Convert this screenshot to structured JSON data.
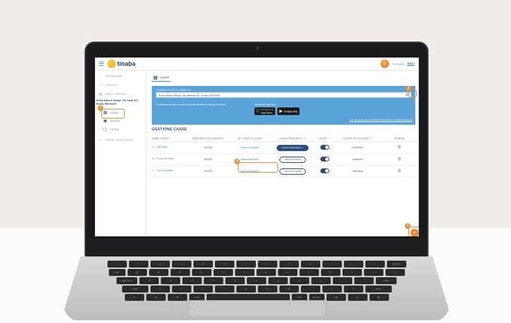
{
  "header": {
    "logo_text": "tinaba",
    "user_name": "TINTINBA",
    "exit_label": "ESCI"
  },
  "sidebar": {
    "items": [
      {
        "label": "DASHBOARD"
      },
      {
        "label": "PROFILO"
      },
      {
        "label": "PUNTI VENDITA"
      }
    ],
    "pv_address": "Roma Marmo Village, Via Casal 547, Roma, RM 00128",
    "sub_items": [
      {
        "label": "CASSE"
      },
      {
        "label": "SERATE"
      },
      {
        "label": "LISTINI"
      }
    ],
    "grow_label": "GROW YOUR CLIENT"
  },
  "tab": {
    "label": "CASSE"
  },
  "pv_panel": {
    "title": "CAMBIA PUNTO VENDITA",
    "selected": "Roma Marmo Village, Via Ustrenes 547, Roma, RM 00128",
    "help_text": "Per attivare una cassa, inserisci il codice attivazione nell'app per tinaba",
    "store_title": "Disponibile sugli store",
    "app_store_small": "Download on the",
    "app_store_label": "App Store",
    "google_play_label": "Google play",
    "link_text": "a clic qui per sapere come attivare i POS di Amazon e Bitcoin/l'assistenza"
  },
  "section_title": "GESTIONE CASSE",
  "table": {
    "headers": [
      "NOME CASSA",
      "IDENTIFICATIVO UNIVOCO",
      "QR CODE DI CASSA",
      "CASSA PRINCIPALE ⓘ",
      "STATO ⓘ",
      "CODICE ATTIVAZIONE ⓘ",
      "ELIMINA"
    ],
    "rows": [
      {
        "name": "BAR Bisso",
        "id": "1001282",
        "qr": "Scarica espositore",
        "principal": "CASSA PRINCIPALE ✓",
        "code": "mX9RjzBK1"
      },
      {
        "name": "Prova Punt Bisso",
        "id": "1001302",
        "qr": "Scarica espositore",
        "principal": "Cassa Secondaria",
        "code": "ur9yfcpu2c"
      },
      {
        "name": "Prova Log Bisso",
        "id": "1001303",
        "qr": "Scarica espositore",
        "principal": "Cassa Secondaria",
        "code": "qo5iZjnvIs"
      }
    ]
  },
  "callouts": [
    "1",
    "2",
    "3",
    "4"
  ],
  "fab_label": "+",
  "keyboard": {
    "row1": [
      "~",
      "!",
      "@",
      "#",
      "$",
      "%",
      "^",
      "&",
      "*",
      "(",
      ")",
      "_",
      "+",
      "delete"
    ],
    "row2": [
      "tab",
      "Q",
      "W",
      "E",
      "R",
      "T",
      "Y",
      "U",
      "I",
      "O",
      "P",
      "{",
      "}",
      "|"
    ],
    "row3": [
      "caps lock",
      "A",
      "S",
      "D",
      "F",
      "G",
      "H",
      "J",
      "K",
      "L",
      ":",
      "\"",
      "enter"
    ],
    "row4": [
      "shift",
      "Z",
      "X",
      "C",
      "V",
      "B",
      "N",
      "M",
      "<",
      ">",
      "?",
      "shift"
    ],
    "row5": [
      "fn",
      "ctrl",
      "alt",
      "cmd",
      "",
      "cmd",
      "option",
      "◀",
      "▲",
      "▶"
    ]
  },
  "colors": {
    "accent": "#2f8fd0",
    "brand_dark": "#2c4d78",
    "panel_blue": "#5ba4d9",
    "callout_orange": "#f0892f"
  }
}
